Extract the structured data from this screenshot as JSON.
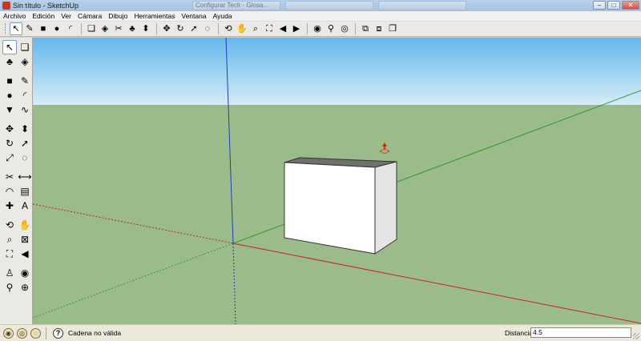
{
  "window": {
    "title": "Sin título - SketchUp",
    "ghost_tabs": [
      "Configurar Teclr - Glosa...",
      "",
      ""
    ],
    "controls": {
      "minimize": "–",
      "maximize": "□",
      "close": "✕"
    }
  },
  "menu": {
    "items": [
      "Archivo",
      "Edición",
      "Ver",
      "Cámara",
      "Dibujo",
      "Herramientas",
      "Ventana",
      "Ayuda"
    ]
  },
  "toolbar": {
    "tools": [
      {
        "name": "select",
        "glyph": "↖",
        "active": true
      },
      {
        "name": "line",
        "glyph": "✎"
      },
      {
        "name": "rectangle",
        "glyph": "■"
      },
      {
        "name": "circle",
        "glyph": "●"
      },
      {
        "name": "arc",
        "glyph": "◜"
      },
      {
        "name": "make-component",
        "glyph": "❏"
      },
      {
        "name": "eraser",
        "glyph": "◈"
      },
      {
        "name": "tape-measure",
        "glyph": "✂"
      },
      {
        "name": "paint-bucket",
        "glyph": "♣"
      },
      {
        "name": "push-pull",
        "glyph": "⬍"
      },
      {
        "name": "move",
        "glyph": "✥"
      },
      {
        "name": "rotate",
        "glyph": "↻"
      },
      {
        "name": "follow-me",
        "glyph": "➚"
      },
      {
        "name": "offset",
        "glyph": "◌"
      },
      {
        "name": "orbit",
        "glyph": "⟲"
      },
      {
        "name": "pan",
        "glyph": "✋"
      },
      {
        "name": "zoom",
        "glyph": "⌕"
      },
      {
        "name": "zoom-extents",
        "glyph": "⛶"
      },
      {
        "name": "previous",
        "glyph": "◀"
      },
      {
        "name": "next",
        "glyph": "▶"
      },
      {
        "name": "camera",
        "glyph": "◉"
      },
      {
        "name": "walk",
        "glyph": "⚲"
      },
      {
        "name": "look-around",
        "glyph": "◎"
      },
      {
        "name": "get-models",
        "glyph": "⧉"
      },
      {
        "name": "share-model",
        "glyph": "⧈"
      },
      {
        "name": "get-photo-texture",
        "glyph": "❐"
      }
    ]
  },
  "left_toolbar": {
    "tools": [
      {
        "name": "select",
        "glyph": "↖",
        "active": true
      },
      {
        "name": "make-component",
        "glyph": "❏"
      },
      {
        "name": "paint-bucket",
        "glyph": "♣"
      },
      {
        "name": "eraser",
        "glyph": "◈"
      },
      {
        "name": "rectangle",
        "glyph": "■"
      },
      {
        "name": "line",
        "glyph": "✎"
      },
      {
        "name": "circle",
        "glyph": "●"
      },
      {
        "name": "arc",
        "glyph": "◜"
      },
      {
        "name": "polygon",
        "glyph": "▼"
      },
      {
        "name": "freehand",
        "glyph": "∿"
      },
      {
        "name": "move",
        "glyph": "✥"
      },
      {
        "name": "push-pull",
        "glyph": "⬍"
      },
      {
        "name": "rotate",
        "glyph": "↻"
      },
      {
        "name": "follow-me",
        "glyph": "➚"
      },
      {
        "name": "scale",
        "glyph": "⤢"
      },
      {
        "name": "offset",
        "glyph": "◌"
      },
      {
        "name": "tape-measure",
        "glyph": "✂"
      },
      {
        "name": "dimension",
        "glyph": "⟷"
      },
      {
        "name": "protractor",
        "glyph": "◠"
      },
      {
        "name": "text",
        "glyph": "▤"
      },
      {
        "name": "axes",
        "glyph": "✚"
      },
      {
        "name": "3d-text",
        "glyph": "A"
      },
      {
        "name": "orbit",
        "glyph": "⟲"
      },
      {
        "name": "pan",
        "glyph": "✋"
      },
      {
        "name": "zoom",
        "glyph": "⌕"
      },
      {
        "name": "zoom-window",
        "glyph": "⊠"
      },
      {
        "name": "zoom-extents",
        "glyph": "⛶"
      },
      {
        "name": "previous",
        "glyph": "◀"
      },
      {
        "name": "position-camera",
        "glyph": "♙"
      },
      {
        "name": "look-around",
        "glyph": "◉"
      },
      {
        "name": "walk",
        "glyph": "⚲"
      },
      {
        "name": "section-plane",
        "glyph": "⊕"
      }
    ]
  },
  "scene": {
    "sky_top": "#63b7ec",
    "sky_bottom": "#d6ecf8",
    "ground": "#9bbb8a",
    "axis_colors": {
      "x": "#c8202a",
      "y": "#2e9a2e",
      "z": "#1f3fb5"
    },
    "box_face": "#ffffff",
    "box_side": "#e4e4e4",
    "box_top": "#6f6f6f"
  },
  "status": {
    "message": "Cadena no válida",
    "measure_label": "Distancia",
    "measure_value": "4.5"
  }
}
